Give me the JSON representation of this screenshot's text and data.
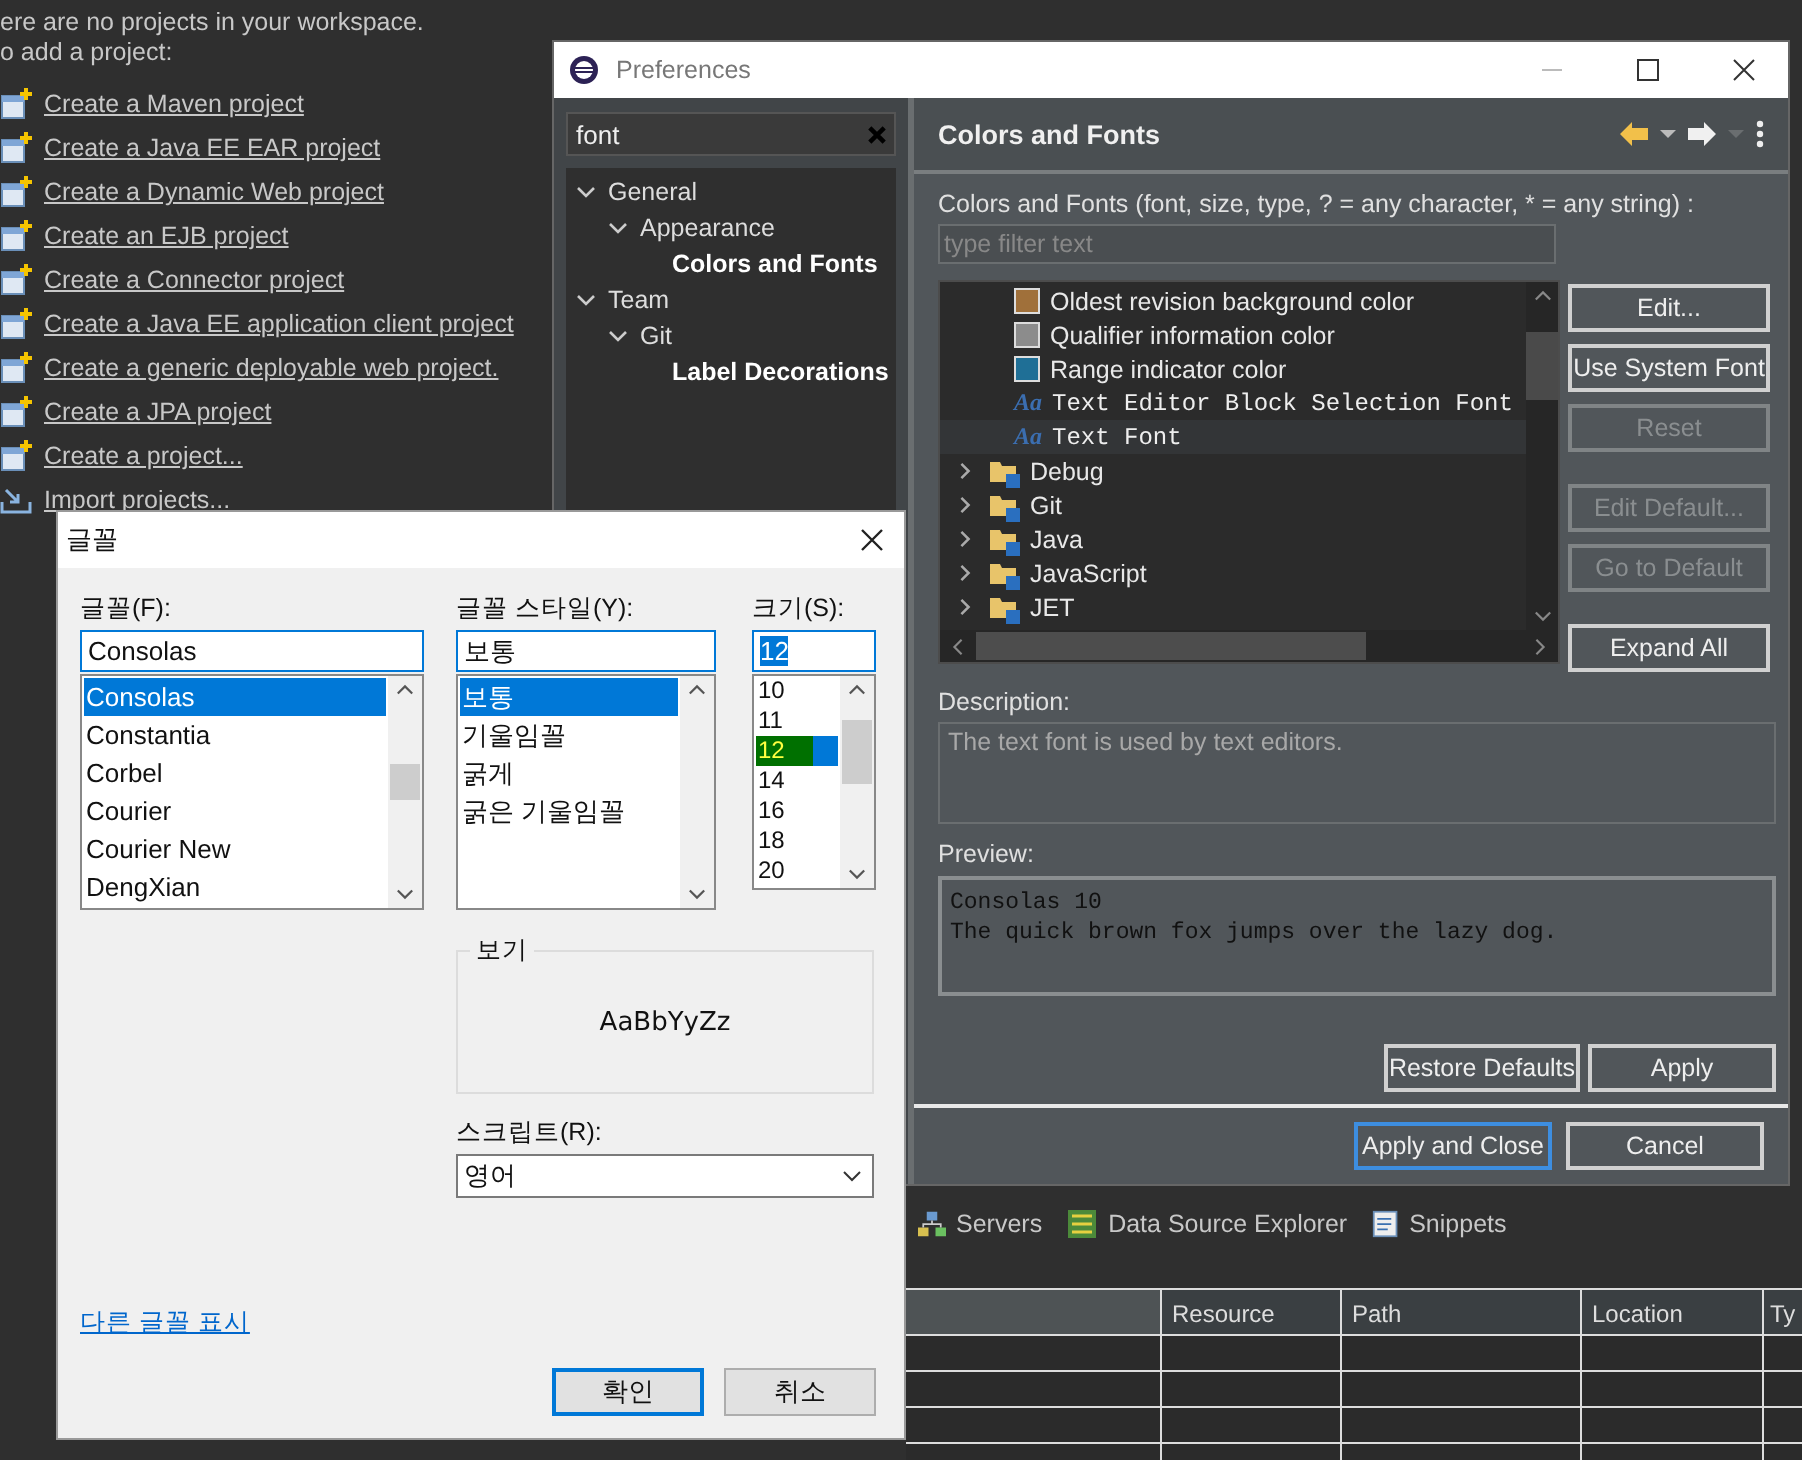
{
  "workspace": {
    "intro": [
      "ere are no projects in your workspace.",
      "o add a project:"
    ],
    "links": [
      {
        "label": "Create a Maven project",
        "kind": "create"
      },
      {
        "label": "Create a Java EE EAR project",
        "kind": "create"
      },
      {
        "label": "Create a Dynamic Web project",
        "kind": "create"
      },
      {
        "label": "Create an EJB project",
        "kind": "create"
      },
      {
        "label": "Create a Connector project",
        "kind": "create"
      },
      {
        "label": "Create a Java EE application client project",
        "kind": "create"
      },
      {
        "label": "Create a generic deployable web project.",
        "kind": "create"
      },
      {
        "label": "Create a JPA project",
        "kind": "create"
      },
      {
        "label": "Create a project...",
        "kind": "create"
      },
      {
        "label": "Import projects...",
        "kind": "import"
      }
    ]
  },
  "bottom_tabs": [
    {
      "label": "Servers",
      "kind": "servers"
    },
    {
      "label": "Data Source Explorer",
      "kind": "datasource"
    },
    {
      "label": "Snippets",
      "kind": "snippets"
    }
  ],
  "table": {
    "columns": [
      "Resource",
      "Path",
      "Location",
      "Ty"
    ]
  },
  "preferences": {
    "title": "Preferences",
    "filter": {
      "value": "font"
    },
    "tree": [
      {
        "label": "General",
        "expanded": true,
        "match": false,
        "children": [
          {
            "label": "Appearance",
            "expanded": true,
            "match": false,
            "children": [
              {
                "label": "Colors and Fonts",
                "match": true
              }
            ]
          }
        ]
      },
      {
        "label": "Team",
        "expanded": true,
        "match": false,
        "children": [
          {
            "label": "Git",
            "expanded": true,
            "match": false,
            "children": [
              {
                "label": "Label Decorations",
                "match": true
              }
            ]
          }
        ]
      }
    ],
    "page_title": "Colors and Fonts",
    "hint": "Colors and Fonts (font, size, type, ? = any character, * = any string) :",
    "list_filter": {
      "placeholder": "type filter text"
    },
    "items": [
      {
        "kind": "color",
        "label": "Oldest revision background color",
        "color": "#a0703a",
        "selected": false
      },
      {
        "kind": "color",
        "label": "Qualifier information color",
        "color": "#8c8c8c",
        "selected": false
      },
      {
        "kind": "color",
        "label": "Range indicator color",
        "color": "#1f6f96",
        "selected": false
      },
      {
        "kind": "font",
        "glyph": "Aa",
        "label": "Text Editor Block Selection Font",
        "selected": false
      },
      {
        "kind": "font",
        "glyph": "Aa",
        "label": "Text Font",
        "selected": true
      },
      {
        "kind": "category",
        "label": "Debug",
        "expanded": false
      },
      {
        "kind": "category",
        "label": "Git",
        "expanded": false
      },
      {
        "kind": "category",
        "label": "Java",
        "expanded": false
      },
      {
        "kind": "category",
        "label": "JavaScript",
        "expanded": false
      },
      {
        "kind": "category",
        "label": "JET",
        "expanded": false
      }
    ],
    "side_buttons": [
      {
        "label": "Edit...",
        "disabled": false
      },
      {
        "label": "Use System Font",
        "disabled": false
      },
      {
        "label": "Reset",
        "disabled": true
      },
      {
        "label": "Edit Default...",
        "disabled": true
      },
      {
        "label": "Go to Default",
        "disabled": true
      },
      {
        "label": "Expand All",
        "disabled": false
      }
    ],
    "description_label": "Description:",
    "description": "The text font is used by text editors.",
    "preview_label": "Preview:",
    "preview_lines": [
      "Consolas 10",
      "The quick brown fox jumps over the lazy dog."
    ],
    "page_buttons": [
      "Restore Defaults",
      "Apply"
    ],
    "dialog_buttons": [
      {
        "label": "Apply and Close",
        "default": true
      },
      {
        "label": "Cancel",
        "default": false
      }
    ]
  },
  "font_dialog": {
    "title": "글꼴",
    "font": {
      "label": "글꼴(F):",
      "value": "Consolas",
      "options": [
        {
          "label": "Consolas",
          "selected": true
        },
        {
          "label": "Constantia",
          "selected": false
        },
        {
          "label": "Corbel",
          "selected": false
        },
        {
          "label": "Courier",
          "selected": false
        },
        {
          "label": "Courier New",
          "selected": false
        },
        {
          "label": "DengXian",
          "selected": false
        }
      ]
    },
    "style": {
      "label": "글꼴 스타일(Y):",
      "value": "보통",
      "options": [
        {
          "label": "보통",
          "selected": true
        },
        {
          "label": "기울임꼴",
          "selected": false
        },
        {
          "label": "굵게",
          "selected": false
        },
        {
          "label": "굵은 기울임꼴",
          "selected": false
        }
      ]
    },
    "size": {
      "label": "크기(S):",
      "value": "12",
      "options": [
        {
          "label": "10",
          "selected": false
        },
        {
          "label": "11",
          "selected": false
        },
        {
          "label": "12",
          "selected": true
        },
        {
          "label": "14",
          "selected": false
        },
        {
          "label": "16",
          "selected": false
        },
        {
          "label": "18",
          "selected": false
        },
        {
          "label": "20",
          "selected": false
        }
      ]
    },
    "sample_label": "보기",
    "sample": "AaBbYyZz",
    "script": {
      "label": "스크립트(R):",
      "value": "영어"
    },
    "more_link": "다른 글꼴 표시",
    "buttons": [
      {
        "label": "확인",
        "default": true
      },
      {
        "label": "취소",
        "default": false
      }
    ]
  }
}
